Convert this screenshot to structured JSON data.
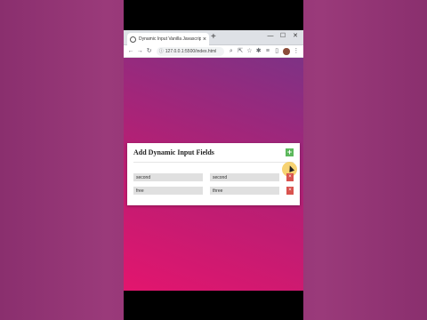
{
  "browser": {
    "tab_title": "Dynamic Input Vanilla Javascript",
    "tab_close": "×",
    "new_tab": "+",
    "url": "127.0.0.1:5500/index.html",
    "window_controls": [
      "—",
      "☐",
      "✕"
    ]
  },
  "page": {
    "title": "Add Dynamic Input Fields",
    "add_label": "+",
    "rows": [
      {
        "first": "second",
        "second": "second",
        "remove_label": "×"
      },
      {
        "first": "free",
        "second": "three",
        "remove_label": "×"
      }
    ]
  },
  "colors": {
    "add_button": "#5cb85c",
    "remove_button": "#d9534f",
    "gradient_start": "#e3156e",
    "gradient_end": "#7e3285"
  }
}
